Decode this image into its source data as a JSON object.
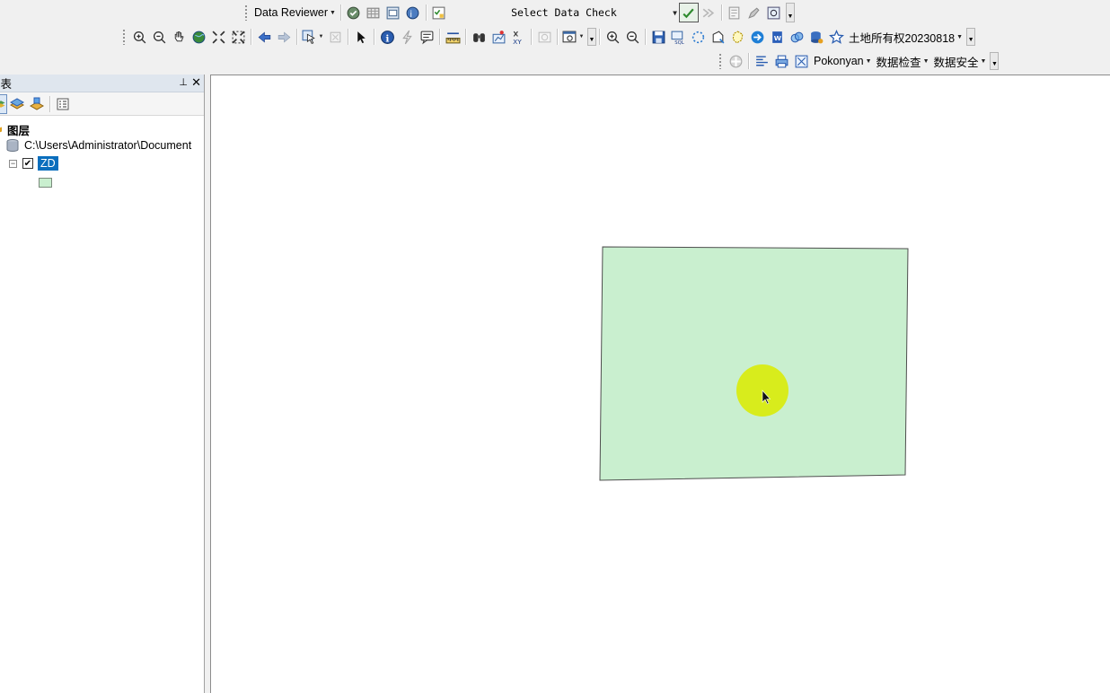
{
  "toolbar_row1": {
    "reviewer_label": "Data Reviewer",
    "data_check_value": "Select Data Check"
  },
  "toolbar_row2": {
    "landright_label": "土地所有权20230818"
  },
  "toolbar_row3": {
    "pokonyan_label": "Pokonyan",
    "data_check_menu": "数据检查",
    "data_security_menu": "数据安全"
  },
  "toc": {
    "title": "列表",
    "layers_label": "图层",
    "database_path": "C:\\Users\\Administrator\\Document",
    "layer_name": "ZD"
  },
  "colors": {
    "polygon_fill": "#c9efcf",
    "polygon_stroke": "#4e4e4e",
    "cursor_highlight": "#d8ec1c",
    "selected_label": "#0a6ebd"
  }
}
